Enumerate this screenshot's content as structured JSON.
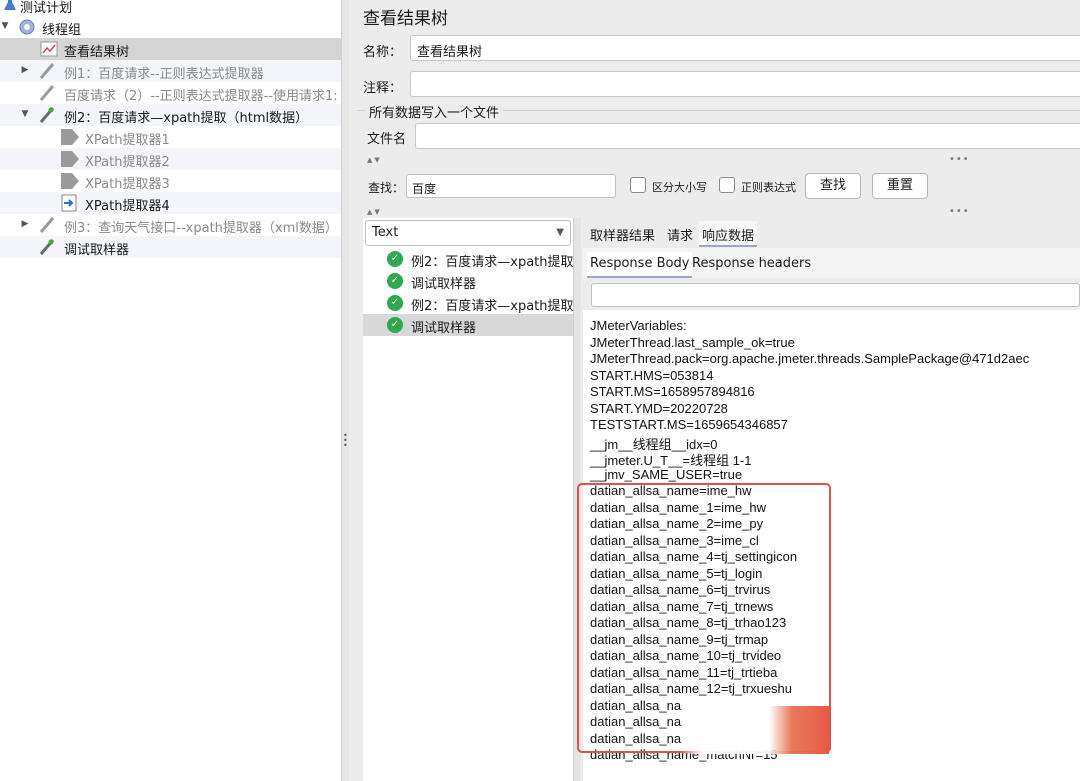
{
  "tree": {
    "items": [
      {
        "label": "测试计划",
        "level": 0
      },
      {
        "label": "线程组",
        "level": 0
      },
      {
        "label": "查看结果树",
        "level": 1
      },
      {
        "label": "例1：百度请求--正则表达式提取器",
        "level": 1
      },
      {
        "label": "百度请求（2）--正则表达式提取器--使用请求1:",
        "level": 1
      },
      {
        "label": "例2：百度请求—xpath提取（html数据）",
        "level": 1
      },
      {
        "label": "XPath提取器1",
        "level": 2
      },
      {
        "label": "XPath提取器2",
        "level": 2
      },
      {
        "label": "XPath提取器3",
        "level": 2
      },
      {
        "label": "XPath提取器4",
        "level": 2
      },
      {
        "label": "例3：查询天气接口--xpath提取器（xml数据）",
        "level": 1
      },
      {
        "label": "调试取样器",
        "level": 1
      }
    ]
  },
  "panel": {
    "title": "查看结果树",
    "name_label": "名称：",
    "name_value": "查看结果树",
    "comment_label": "注释：",
    "comment_value": "",
    "group_label": "所有数据写入一个文件",
    "filename_label": "文件名",
    "filename_value": ""
  },
  "search": {
    "label": "查找：",
    "value": "百度",
    "case_label": "区分大小写",
    "regex_label": "正则表达式",
    "find_button": "查找",
    "reset_button": "重置"
  },
  "results": {
    "renderer": "Text",
    "items": [
      {
        "label": "例2：百度请求—xpath提取",
        "status": "success"
      },
      {
        "label": "调试取样器",
        "status": "success"
      },
      {
        "label": "例2：百度请求—xpath提取",
        "status": "success"
      },
      {
        "label": "调试取样器",
        "status": "success"
      }
    ]
  },
  "tabs": [
    "取样器结果",
    "请求",
    "响应数据"
  ],
  "active_tab": "响应数据",
  "subtabs": [
    "Response Body",
    "Response headers"
  ],
  "active_subtab": "Response Body",
  "response_lines": [
    "JMeterVariables:",
    "JMeterThread.last_sample_ok=true",
    "JMeterThread.pack=org.apache.jmeter.threads.SamplePackage@471d2aec",
    "START.HMS=053814",
    "START.MS=1658957894816",
    "START.YMD=20220728",
    "TESTSTART.MS=1659654346857",
    "__jm__线程组__idx=0",
    "__jmeter.U_T__=线程组 1-1",
    "__jmv_SAME_USER=true",
    "datian_allsa_name=ime_hw",
    "datian_allsa_name_1=ime_hw",
    "datian_allsa_name_2=ime_py",
    "datian_allsa_name_3=ime_cl",
    "datian_allsa_name_4=tj_settingicon",
    "datian_allsa_name_5=tj_login",
    "datian_allsa_name_6=tj_trvirus",
    "datian_allsa_name_7=tj_trnews",
    "datian_allsa_name_8=tj_trhao123",
    "datian_allsa_name_9=tj_trmap",
    "datian_allsa_name_10=tj_trvideo",
    "datian_allsa_name_11=tj_trtieba",
    "datian_allsa_name_12=tj_trxueshu",
    "datian_allsa_na",
    "datian_allsa_na",
    "datian_allsa_na",
    "datian_allsa_name_matchNr=15"
  ],
  "colors": {
    "highlight": "#d9534f",
    "success": "#2fa84f"
  }
}
